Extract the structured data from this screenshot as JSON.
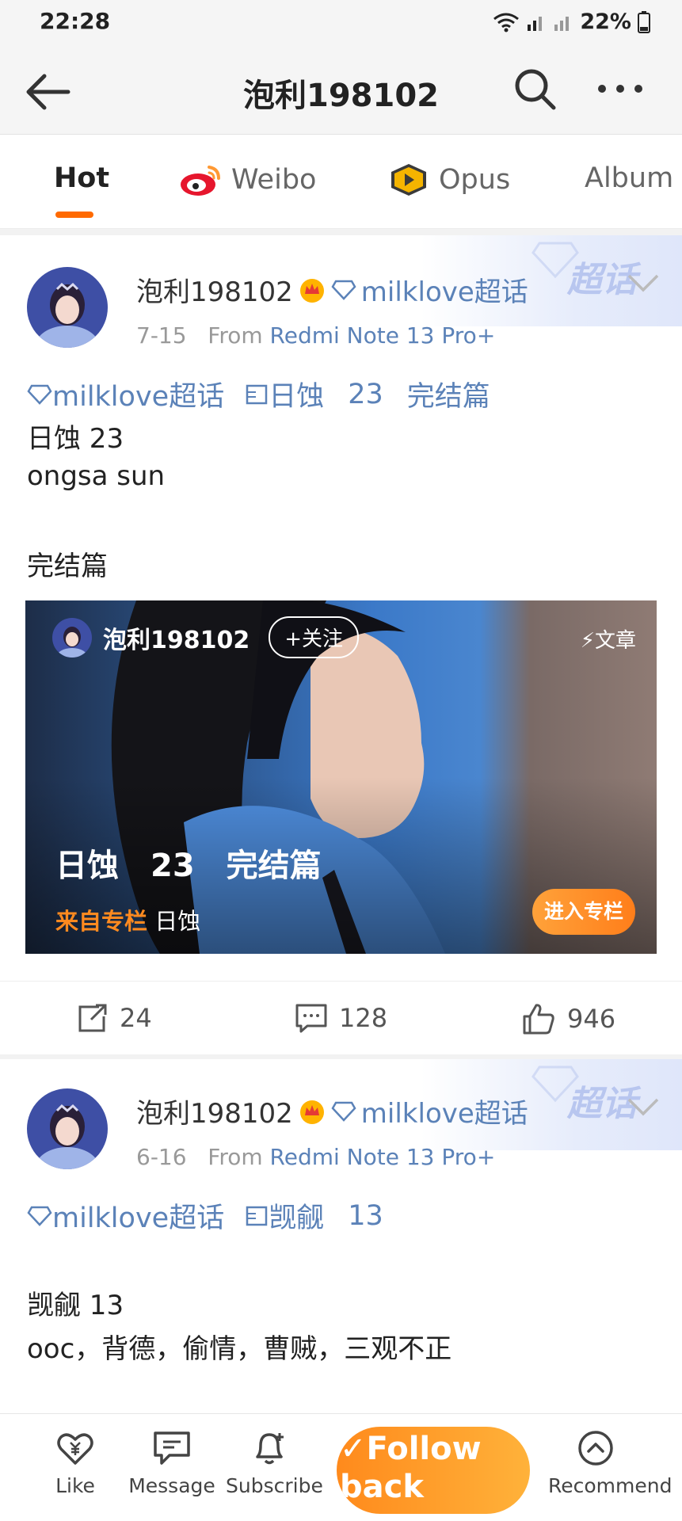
{
  "status_bar": {
    "time": "22:28",
    "battery": "22%"
  },
  "nav": {
    "title": "泡利198102"
  },
  "tabs": [
    {
      "label": "Hot",
      "active": true
    },
    {
      "label": "Weibo",
      "active": false
    },
    {
      "label": "Opus",
      "active": false
    },
    {
      "label": "Album",
      "active": false
    }
  ],
  "posts": [
    {
      "author": "泡利198102",
      "topic": "milklove超话",
      "banner": "超话",
      "date": "7-15",
      "from_prefix": "From",
      "device": "Redmi Note 13 Pro+",
      "tags": [
        "milklove超话",
        "日蚀",
        "23",
        "完结篇"
      ],
      "lines": [
        "日蚀 23",
        "ongsa sun",
        "完结篇"
      ],
      "article": {
        "author": "泡利198102",
        "follow_label": "+关注",
        "type_label": "文章",
        "title": "日蚀　23　完结篇",
        "from_source": "来自专栏",
        "column": "日蚀",
        "enter_label": "进入专栏"
      },
      "actions": {
        "reposts": "24",
        "comments": "128",
        "likes": "946"
      }
    },
    {
      "author": "泡利198102",
      "topic": "milklove超话",
      "banner": "超话",
      "date": "6-16",
      "from_prefix": "From",
      "device": "Redmi Note 13 Pro+",
      "tags": [
        "milklove超话",
        "觊觎",
        "13"
      ],
      "lines": [
        "觊觎 13",
        "ooc，背德，偷情，曹贼，三观不正"
      ]
    }
  ],
  "bottom_bar": {
    "like": "Like",
    "message": "Message",
    "subscribe": "Subscribe",
    "follow_back": "Follow back",
    "recommend": "Recommend"
  },
  "colors": {
    "accent": "#ff6a00",
    "link": "#5b82b8",
    "follow": "#ffa030"
  }
}
